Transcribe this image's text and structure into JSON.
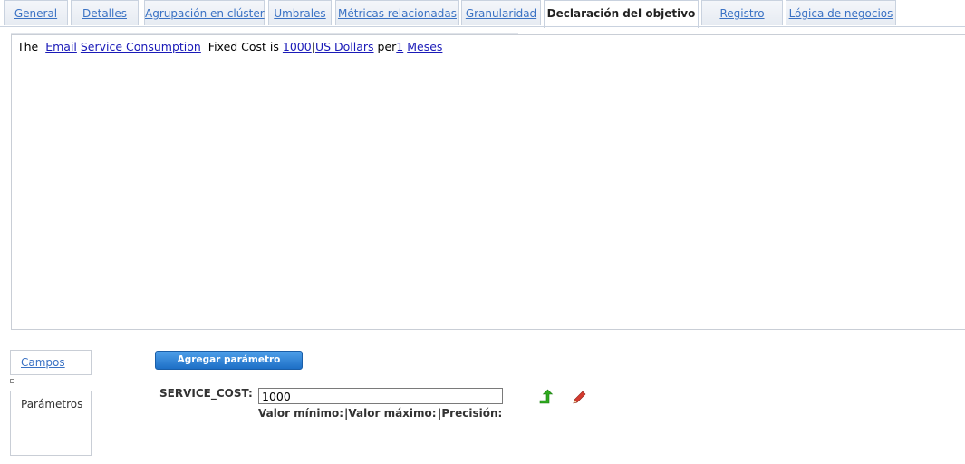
{
  "tabs": [
    {
      "label": "General"
    },
    {
      "label": "Detalles"
    },
    {
      "label": "Agrupación en clúster"
    },
    {
      "label": "Umbrales"
    },
    {
      "label": "Métricas relacionadas"
    },
    {
      "label": "Granularidad"
    },
    {
      "label": "Declaración del objetivo",
      "active": true
    },
    {
      "label": "Registro"
    },
    {
      "label": "Lógica de negocios"
    }
  ],
  "statement": {
    "the": "The",
    "email": "Email",
    "service_consumption": "Service Consumption",
    "fixed_cost_is": "Fixed Cost is",
    "value": "1000",
    "currency": "US Dollars",
    "per": "per",
    "period_count": "1",
    "period_unit": "Meses"
  },
  "side_tabs": {
    "fields": "Campos",
    "parameters": "Parámetros"
  },
  "params": {
    "add_button": "Agregar parámetro",
    "name_label": "SERVICE_COST:",
    "value": "1000",
    "min_label": "Valor mínimo:",
    "max_label": "|Valor máximo:",
    "precision_label": "|Precisión:"
  },
  "colors": {
    "link": "#1a1ab8",
    "tab_link": "#3a72c4",
    "button": "#1d6fc6",
    "up_arrow": "#2eaa1e",
    "pencil": "#c0312b"
  },
  "icons": {
    "move_up": "arrow-up-icon",
    "edit": "pencil-icon"
  }
}
